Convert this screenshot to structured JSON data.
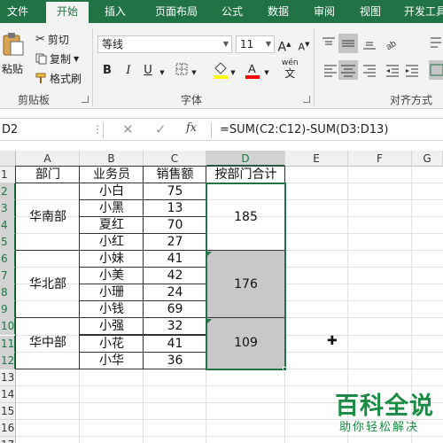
{
  "ribbon_tabs": [
    {
      "label": "文件",
      "active": false
    },
    {
      "label": "开始",
      "active": true
    },
    {
      "label": "插入",
      "active": false
    },
    {
      "label": "页面布局",
      "active": false
    },
    {
      "label": "公式",
      "active": false
    },
    {
      "label": "数据",
      "active": false
    },
    {
      "label": "审阅",
      "active": false
    },
    {
      "label": "视图",
      "active": false
    },
    {
      "label": "开发工具",
      "active": false
    }
  ],
  "clipboard": {
    "paste": "粘贴",
    "cut": "剪切",
    "copy": "复制",
    "format_painter": "格式刷",
    "group_label": "剪贴板"
  },
  "font": {
    "name": "等线",
    "size": "11",
    "group_label": "字体",
    "bold": "B",
    "italic": "I",
    "underline": "U",
    "grow": "A",
    "shrink": "A",
    "pinyin": "wén",
    "pinyin_char": "文",
    "fill_color": "#ffff00",
    "font_color": "#ff0000"
  },
  "alignment": {
    "group_label": "对齐方式"
  },
  "formula_bar": {
    "name_box": "D2",
    "fx": "fx",
    "formula": "=SUM(C2:C12)-SUM(D3:D13)"
  },
  "grid": {
    "columns": [
      "A",
      "B",
      "C",
      "D",
      "E",
      "F",
      "G"
    ],
    "rows": [
      "1",
      "2",
      "3",
      "4",
      "5",
      "6",
      "7",
      "8",
      "9",
      "10",
      "11",
      "12",
      "13",
      "14",
      "15",
      "16",
      "17"
    ],
    "headers": [
      "部门",
      "业务员",
      "销售额",
      "按部门合计"
    ],
    "departments": [
      {
        "name": "华南部",
        "total": "185"
      },
      {
        "name": "华北部",
        "total": "176"
      },
      {
        "name": "华中部",
        "total": "109"
      }
    ],
    "records": [
      {
        "person": "小白",
        "sales": "75"
      },
      {
        "person": "小黑",
        "sales": "13"
      },
      {
        "person": "夏红",
        "sales": "70"
      },
      {
        "person": "小红",
        "sales": "27"
      },
      {
        "person": "小妹",
        "sales": "41"
      },
      {
        "person": "小美",
        "sales": "42"
      },
      {
        "person": "小珊",
        "sales": "24"
      },
      {
        "person": "小钱",
        "sales": "69"
      },
      {
        "person": "小强",
        "sales": "32"
      },
      {
        "person": "小花",
        "sales": "41"
      },
      {
        "person": "小华",
        "sales": "36"
      }
    ]
  },
  "watermark": {
    "logo": "百科全说",
    "subtitle": "助你轻松解决"
  }
}
